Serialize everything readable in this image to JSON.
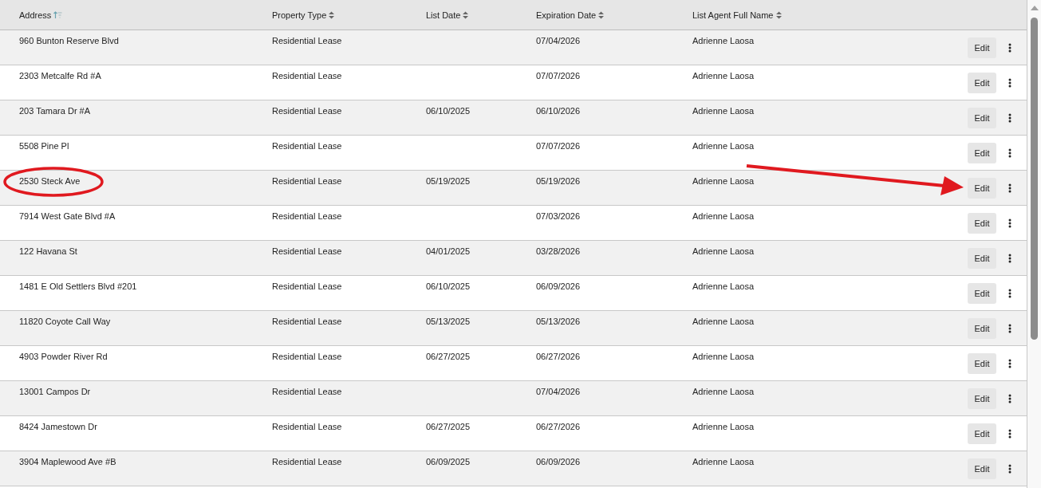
{
  "table": {
    "columns": [
      {
        "label": "Address",
        "sorted": true
      },
      {
        "label": "Property Type",
        "sorted": false
      },
      {
        "label": "List Date",
        "sorted": false
      },
      {
        "label": "Expiration Date",
        "sorted": false
      },
      {
        "label": "List Agent Full Name",
        "sorted": false
      }
    ],
    "rows": [
      {
        "cells": [
          "960 Bunton Reserve Blvd",
          "Residential Lease",
          "",
          "07/04/2026",
          "Adrienne Laosa"
        ],
        "action": "Edit"
      },
      {
        "cells": [
          "2303 Metcalfe Rd #A",
          "Residential Lease",
          "",
          "07/07/2026",
          "Adrienne Laosa"
        ],
        "action": "Edit"
      },
      {
        "cells": [
          "203 Tamara Dr #A",
          "Residential Lease",
          "06/10/2025",
          "06/10/2026",
          "Adrienne Laosa"
        ],
        "action": "Edit"
      },
      {
        "cells": [
          "5508 Pine Pl",
          "Residential Lease",
          "",
          "07/07/2026",
          "Adrienne Laosa"
        ],
        "action": "Edit"
      },
      {
        "cells": [
          "2530 Steck Ave",
          "Residential Lease",
          "05/19/2025",
          "05/19/2026",
          "Adrienne Laosa"
        ],
        "action": "Edit",
        "circled": true,
        "arrowed": true
      },
      {
        "cells": [
          "7914 West Gate Blvd #A",
          "Residential Lease",
          "",
          "07/03/2026",
          "Adrienne Laosa"
        ],
        "action": "Edit"
      },
      {
        "cells": [
          "122 Havana St",
          "Residential Lease",
          "04/01/2025",
          "03/28/2026",
          "Adrienne Laosa"
        ],
        "action": "Edit"
      },
      {
        "cells": [
          "1481 E Old Settlers Blvd #201",
          "Residential Lease",
          "06/10/2025",
          "06/09/2026",
          "Adrienne Laosa"
        ],
        "action": "Edit"
      },
      {
        "cells": [
          "11820 Coyote Call Way",
          "Residential Lease",
          "05/13/2025",
          "05/13/2026",
          "Adrienne Laosa"
        ],
        "action": "Edit"
      },
      {
        "cells": [
          "4903 Powder River Rd",
          "Residential Lease",
          "06/27/2025",
          "06/27/2026",
          "Adrienne Laosa"
        ],
        "action": "Edit"
      },
      {
        "cells": [
          "13001 Campos Dr",
          "Residential Lease",
          "",
          "07/04/2026",
          "Adrienne Laosa"
        ],
        "action": "Edit"
      },
      {
        "cells": [
          "8424 Jamestown Dr",
          "Residential Lease",
          "06/27/2025",
          "06/27/2026",
          "Adrienne Laosa"
        ],
        "action": "Edit"
      },
      {
        "cells": [
          "3904 Maplewood Ave #B",
          "Residential Lease",
          "06/09/2025",
          "06/09/2026",
          "Adrienne Laosa"
        ],
        "action": "Edit"
      }
    ]
  }
}
